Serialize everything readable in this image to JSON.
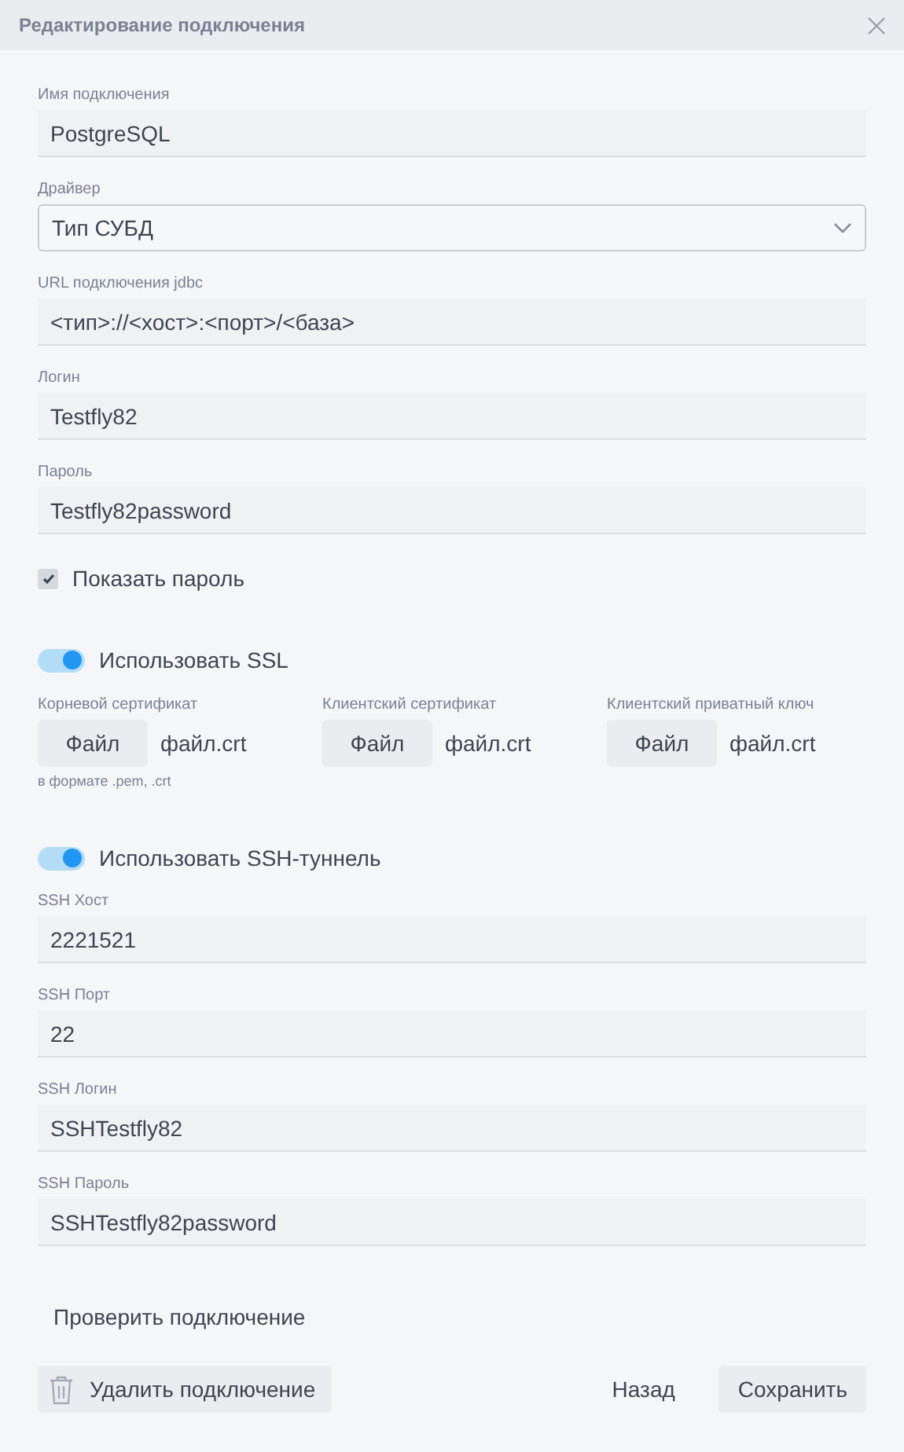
{
  "dialog": {
    "title": "Редактирование подключения"
  },
  "fields": [
    {
      "kind": "text",
      "label": "Имя подключения",
      "value": "PostgreSQL"
    },
    {
      "kind": "select",
      "label": "Драйвер",
      "value": "Тип СУБД"
    },
    {
      "kind": "text",
      "label": "URL подключения jdbc",
      "value": "<тип>://<хост>:<порт>/<база>"
    },
    {
      "kind": "text",
      "label": "Логин",
      "value": "Testfly82"
    },
    {
      "kind": "text",
      "label": "Пароль",
      "value": "Testfly82password"
    }
  ],
  "show_password": {
    "label": "Показать пароль",
    "checked": true
  },
  "ssl": {
    "label": "Использовать SSL",
    "on": true,
    "certificates": [
      {
        "label": "Корневой сертификат",
        "button": "Файл",
        "file": "файл.crt"
      },
      {
        "label": "Клиентский сертификат",
        "button": "Файл",
        "file": "файл.crt"
      },
      {
        "label": "Клиентский приватный ключ",
        "button": "Файл",
        "file": "файл.crt"
      }
    ],
    "hint": "в формате .pem, .crt"
  },
  "ssh": {
    "label": "Использовать SSH-туннель",
    "on": true,
    "fields": [
      {
        "kind": "text",
        "label": "SSH Хост",
        "value": "2221521"
      },
      {
        "kind": "text",
        "label": "SSH Порт",
        "value": "22"
      },
      {
        "kind": "text",
        "label": "SSH Логин",
        "value": "SSHTestfly82"
      },
      {
        "kind": "text",
        "label": "SSH Пароль",
        "value": "SSHTestfly82password"
      }
    ]
  },
  "check_button": "Проверить подключение",
  "footer": {
    "delete_button": "Удалить подключение",
    "back_button": "Назад",
    "save_button": "Сохранить"
  }
}
